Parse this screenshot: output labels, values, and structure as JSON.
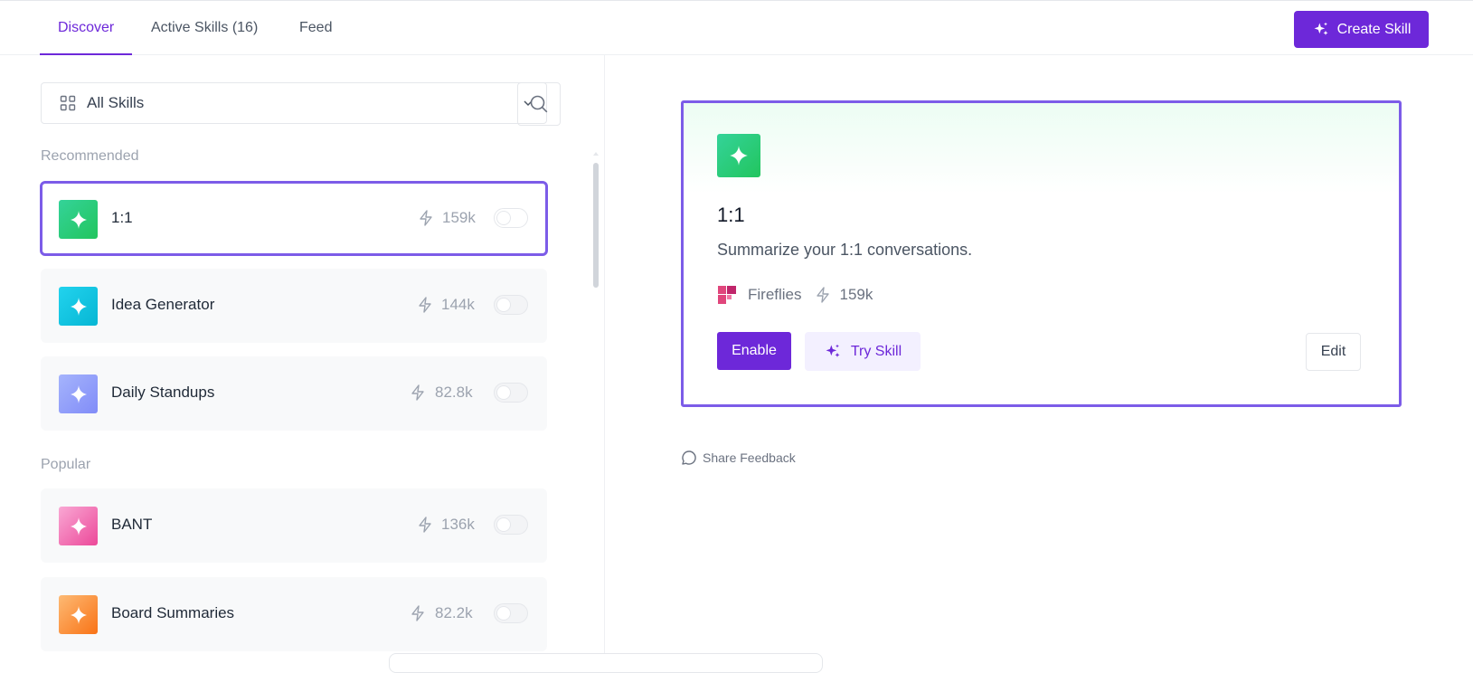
{
  "tabs": [
    {
      "label": "Discover"
    },
    {
      "label": "Active Skills",
      "count": "(16)"
    },
    {
      "label": "Feed"
    }
  ],
  "header": {
    "create_label": "Create Skill"
  },
  "filter": {
    "selected": "All Skills"
  },
  "sections": {
    "recommended": "Recommended",
    "popular": "Popular"
  },
  "skills": [
    {
      "name": "1:1",
      "count": "159k",
      "color": "#22c55e",
      "enabled": false
    },
    {
      "name": "Idea Generator",
      "count": "144k",
      "color": "#22d3ee",
      "enabled": false
    },
    {
      "name": "Daily Standups",
      "count": "82.8k",
      "color": "#818cf8",
      "enabled": false
    },
    {
      "name": "BANT",
      "count": "136k",
      "color": "#f472b6",
      "enabled": false
    },
    {
      "name": "Board Summaries",
      "count": "82.2k",
      "color": "#fb923c",
      "enabled": false
    }
  ],
  "detail": {
    "title": "1:1",
    "description": "Summarize your 1:1 conversations.",
    "source": "Fireflies",
    "count": "159k",
    "enable_label": "Enable",
    "try_label": "Try Skill",
    "edit_label": "Edit"
  },
  "feedback": {
    "label": "Share Feedback"
  },
  "colors": {
    "accent": "#6d28d9",
    "selection_border": "#7c5ce8"
  }
}
